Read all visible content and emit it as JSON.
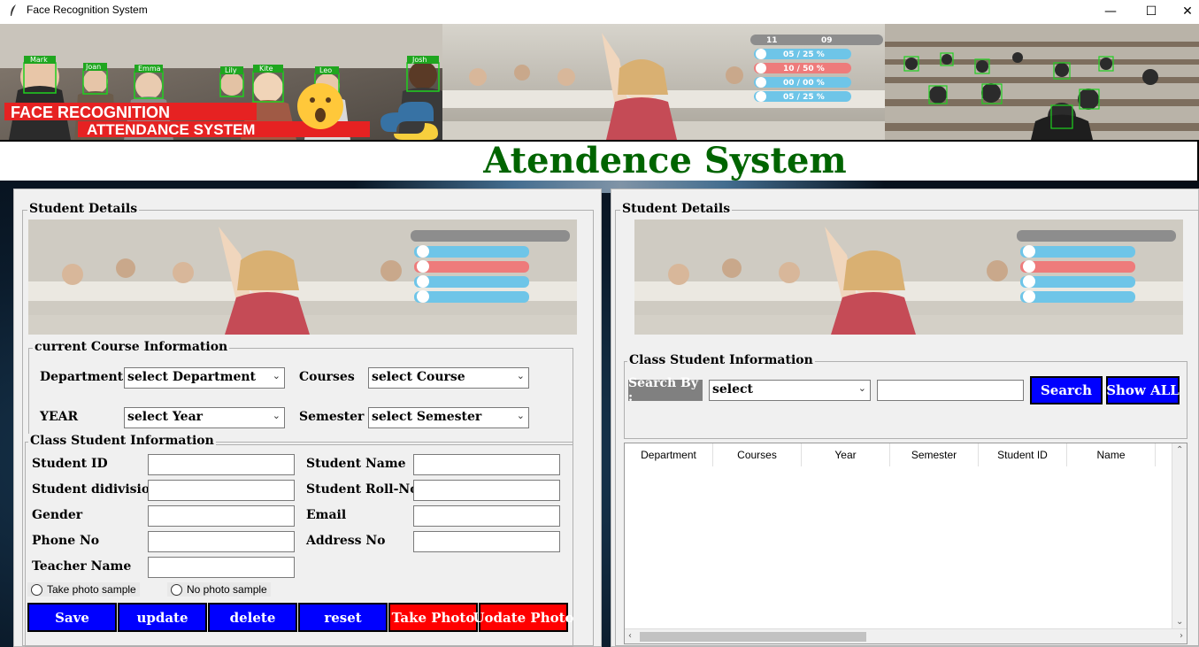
{
  "window": {
    "title": "Face Recognition System",
    "minimize_glyph": "—",
    "maximize_glyph": "☐",
    "close_glyph": "✕"
  },
  "banner": {
    "left_caption_line1": "FACE RECOGNITION",
    "left_caption_line2": "ATTENDANCE SYSTEM",
    "face_tags": [
      "Mark",
      "Joan",
      "Emma",
      "Lily",
      "Kite",
      "Leo",
      "Josh"
    ],
    "stats": [
      "11",
      "09",
      "05 / 25 %",
      "10 / 50 %",
      "00 / 00 %",
      "05 / 25 %"
    ]
  },
  "header": {
    "title": "Atendence System"
  },
  "left_panel": {
    "title": "Student Details",
    "course_frame": {
      "title": "current Course Information",
      "department_label": "Department",
      "department_value": "select Department",
      "courses_label": "Courses",
      "courses_value": "select Course",
      "year_label": "YEAR",
      "year_value": "select Year",
      "semester_label": "Semester",
      "semester_value": "select Semester"
    },
    "class_frame": {
      "title": "Class Student Information",
      "student_id_label": "Student ID",
      "student_name_label": "Student Name",
      "division_label": "Student didivision",
      "roll_label": "Student Roll-No",
      "gender_label": "Gender",
      "email_label": "Email",
      "phone_label": "Phone No",
      "address_label": "Address No",
      "teacher_label": "Teacher Name",
      "radio_take": "Take photo sample",
      "radio_no": "No photo sample"
    },
    "buttons": {
      "save": "Save",
      "update": "update",
      "delete": "delete",
      "reset": "reset",
      "take_photo": "Take Photo",
      "update_photo": "Uodate Photo"
    }
  },
  "right_panel": {
    "title": "Student Details",
    "search_frame": {
      "title": "Class Student Information",
      "search_by_label": "Search By :",
      "search_by_value": "select",
      "search_button": "Search",
      "show_all_button": "Show ALL"
    },
    "table": {
      "columns": [
        "Department",
        "Courses",
        "Year",
        "Semester",
        "Student ID",
        "Name"
      ],
      "rows": []
    }
  },
  "colors": {
    "title_green": "#006400",
    "button_blue": "#0000ff",
    "button_red": "#ff0000",
    "search_label_gray": "#808080"
  }
}
